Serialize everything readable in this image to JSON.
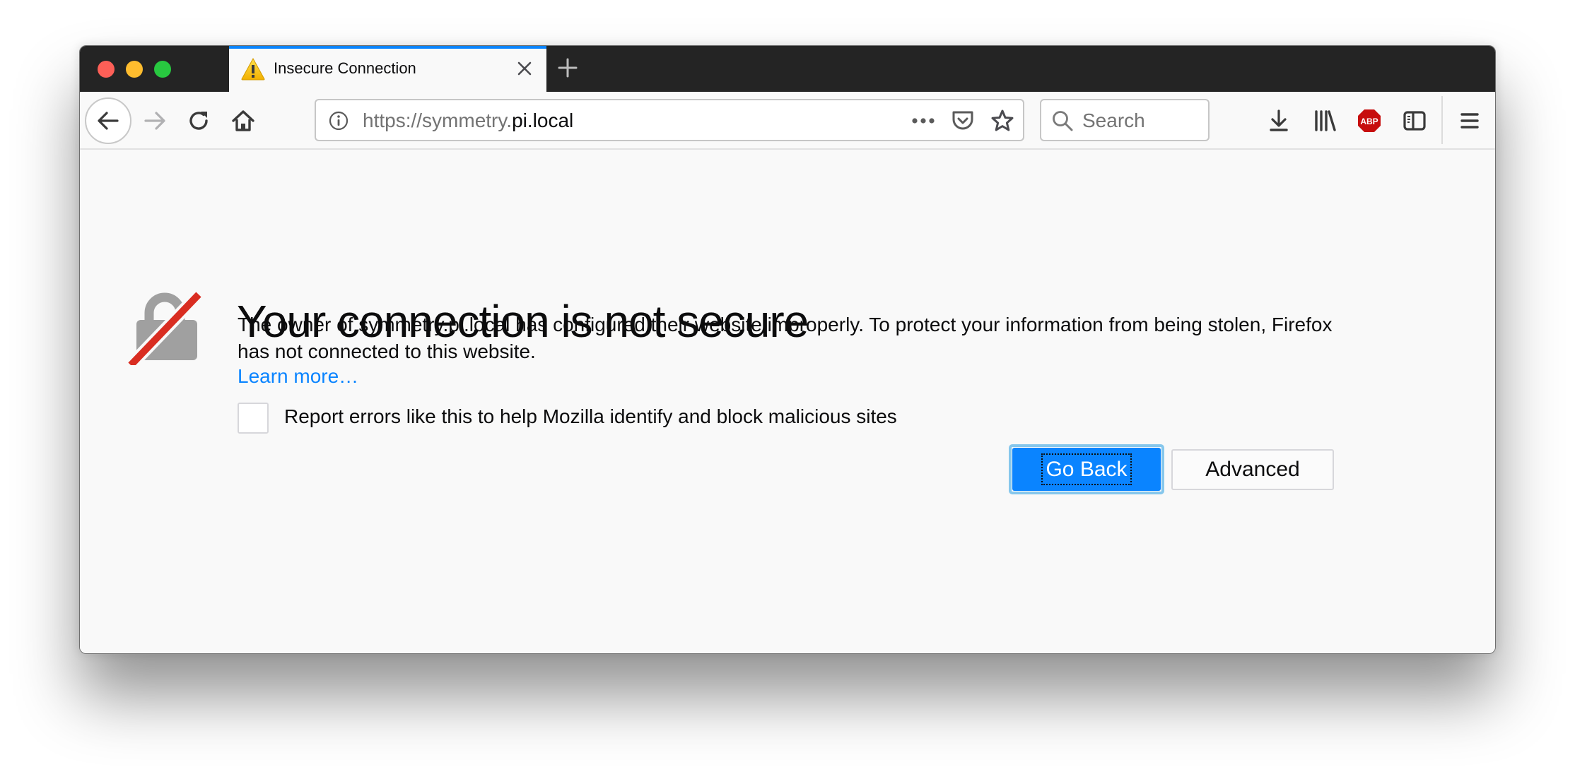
{
  "window": {
    "traffic_lights": [
      "close",
      "minimize",
      "zoom"
    ]
  },
  "tab": {
    "title": "Insecure Connection",
    "icon": "warning-icon",
    "close_icon": "close-icon",
    "active_indicator_color": "#0a84ff"
  },
  "new_tab": {
    "icon": "plus-icon"
  },
  "toolbar": {
    "back_icon": "arrow-left-icon",
    "forward_icon": "arrow-right-icon",
    "reload_icon": "reload-icon",
    "home_icon": "home-icon",
    "url": {
      "scheme_and_subdomain": "https://symmetry.",
      "domain": "pi.local",
      "info_icon": "info-icon",
      "page_actions_icon": "more-dots-icon",
      "pocket_icon": "pocket-icon",
      "bookmark_icon": "star-icon"
    },
    "search": {
      "placeholder": "Search",
      "value": ""
    },
    "right_icons": [
      "download-icon",
      "library-icon",
      "adblock-plus-icon",
      "sidebar-icon",
      "hamburger-menu-icon"
    ],
    "abp_label": "ABP"
  },
  "page": {
    "title": "Your connection is not secure",
    "description": "The owner of symmetry.pi.local has configured their website improperly. To protect your information from being stolen, Firefox has not connected to this website.",
    "learn_more": "Learn more…",
    "report_checkbox": {
      "label": "Report errors like this to help Mozilla identify and block malicious sites",
      "checked": false
    },
    "buttons": {
      "go_back": "Go Back",
      "advanced": "Advanced"
    },
    "colors": {
      "primary": "#0a84ff",
      "link": "#0a84ff",
      "slash": "#d92d21",
      "lock": "#a0a0a0"
    }
  }
}
